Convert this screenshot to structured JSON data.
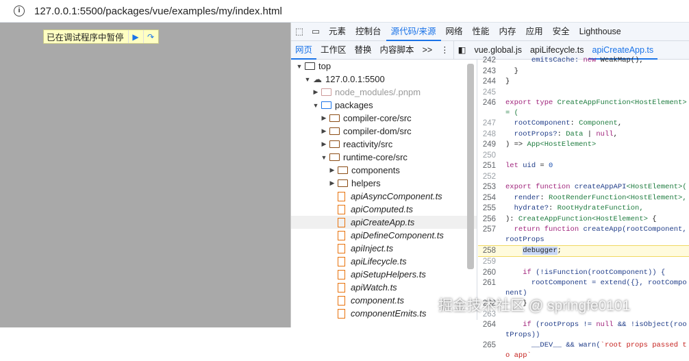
{
  "address_bar": {
    "url": "127.0.0.1:5500/packages/vue/examples/my/index.html"
  },
  "paused_banner": {
    "text": "已在调试程序中暂停"
  },
  "devtools": {
    "main_tabs": [
      "元素",
      "控制台",
      "源代码/来源",
      "网络",
      "性能",
      "内存",
      "应用",
      "安全",
      "Lighthouse"
    ],
    "active_main_tab": 2,
    "sub_tabs": [
      "网页",
      "工作区",
      "替换",
      "内容脚本"
    ],
    "more": ">>",
    "file_tabs": [
      "vue.global.js",
      "apiLifecycle.ts",
      "apiCreateApp.ts"
    ],
    "tree": [
      {
        "label": "top",
        "depth": 0,
        "type": "frame",
        "open": true
      },
      {
        "label": "127.0.0.1:5500",
        "depth": 1,
        "type": "cloud",
        "open": true
      },
      {
        "label": "node_modules/.pnpm",
        "depth": 2,
        "type": "folder-gray",
        "open": false
      },
      {
        "label": "packages",
        "depth": 2,
        "type": "folder-blue",
        "open": true
      },
      {
        "label": "compiler-core/src",
        "depth": 3,
        "type": "folder",
        "open": false
      },
      {
        "label": "compiler-dom/src",
        "depth": 3,
        "type": "folder",
        "open": false
      },
      {
        "label": "reactivity/src",
        "depth": 3,
        "type": "folder",
        "open": false
      },
      {
        "label": "runtime-core/src",
        "depth": 3,
        "type": "folder",
        "open": true
      },
      {
        "label": "components",
        "depth": 4,
        "type": "folder",
        "open": false
      },
      {
        "label": "helpers",
        "depth": 4,
        "type": "folder",
        "open": false
      },
      {
        "label": "apiAsyncComponent.ts",
        "depth": 4,
        "type": "file"
      },
      {
        "label": "apiComputed.ts",
        "depth": 4,
        "type": "file"
      },
      {
        "label": "apiCreateApp.ts",
        "depth": 4,
        "type": "file",
        "selected": true
      },
      {
        "label": "apiDefineComponent.ts",
        "depth": 4,
        "type": "file"
      },
      {
        "label": "apiInject.ts",
        "depth": 4,
        "type": "file"
      },
      {
        "label": "apiLifecycle.ts",
        "depth": 4,
        "type": "file"
      },
      {
        "label": "apiSetupHelpers.ts",
        "depth": 4,
        "type": "file"
      },
      {
        "label": "apiWatch.ts",
        "depth": 4,
        "type": "file"
      },
      {
        "label": "component.ts",
        "depth": 4,
        "type": "file"
      },
      {
        "label": "componentEmits.ts",
        "depth": 4,
        "type": "file"
      }
    ],
    "code": [
      {
        "n": "242",
        "t": [
          [
            "      emitsCache: ",
            "id"
          ],
          [
            "new ",
            "kw"
          ],
          [
            "WeakMap(),",
            "pl"
          ]
        ]
      },
      {
        "n": "243",
        "t": [
          [
            "  }",
            "pl"
          ]
        ]
      },
      {
        "n": "244",
        "t": [
          [
            "}",
            "pl"
          ]
        ]
      },
      {
        "n": "245",
        "t": []
      },
      {
        "n": "246",
        "t": [
          [
            "export type ",
            "kw"
          ],
          [
            "CreateAppFunction<HostElement> = (",
            "ty"
          ]
        ]
      },
      {
        "n": "247",
        "t": [
          [
            "  rootComponent",
            "id"
          ],
          [
            ": ",
            "pl"
          ],
          [
            "Component",
            "ty"
          ],
          [
            ",",
            "pl"
          ]
        ]
      },
      {
        "n": "248",
        "t": [
          [
            "  rootProps?",
            "id"
          ],
          [
            ": ",
            "pl"
          ],
          [
            "Data",
            "ty"
          ],
          [
            " | ",
            "pl"
          ],
          [
            "null",
            "kw"
          ],
          [
            ",",
            "pl"
          ]
        ]
      },
      {
        "n": "249",
        "t": [
          [
            ") => ",
            "pl"
          ],
          [
            "App<HostElement>",
            "ty"
          ]
        ]
      },
      {
        "n": "250",
        "t": []
      },
      {
        "n": "251",
        "t": [
          [
            "let ",
            "kw"
          ],
          [
            "uid",
            "id"
          ],
          [
            " = ",
            "pl"
          ],
          [
            "0",
            "num"
          ]
        ]
      },
      {
        "n": "252",
        "t": []
      },
      {
        "n": "253",
        "t": [
          [
            "export function ",
            "kw"
          ],
          [
            "createAppAPI",
            "id"
          ],
          [
            "<HostElement>(",
            "ty"
          ]
        ]
      },
      {
        "n": "254",
        "t": [
          [
            "  render",
            "id"
          ],
          [
            ": ",
            "pl"
          ],
          [
            "RootRenderFunction<HostElement>,",
            "ty"
          ]
        ]
      },
      {
        "n": "255",
        "t": [
          [
            "  hydrate?",
            "id"
          ],
          [
            ": ",
            "pl"
          ],
          [
            "RootHydrateFunction,",
            "ty"
          ]
        ]
      },
      {
        "n": "256",
        "t": [
          [
            "): ",
            "pl"
          ],
          [
            "CreateAppFunction<HostElement>",
            "ty"
          ],
          [
            " {",
            "pl"
          ]
        ]
      },
      {
        "n": "257",
        "t": [
          [
            "  return function ",
            "kw"
          ],
          [
            "createApp(rootComponent, rootProps",
            "id"
          ]
        ]
      },
      {
        "n": "258",
        "hl": true,
        "t": [
          [
            "    ",
            "pl"
          ],
          [
            "debugger",
            "sel"
          ],
          [
            ";",
            "pl"
          ]
        ]
      },
      {
        "n": "259",
        "t": []
      },
      {
        "n": "260",
        "t": [
          [
            "    if ",
            "kw"
          ],
          [
            "(!isFunction(rootComponent)) {",
            "id"
          ]
        ]
      },
      {
        "n": "261",
        "t": [
          [
            "      rootComponent = extend({}, rootComponent)",
            "id"
          ]
        ]
      },
      {
        "n": "262",
        "t": [
          [
            "    }",
            "pl"
          ]
        ]
      },
      {
        "n": "263",
        "t": []
      },
      {
        "n": "264",
        "t": [
          [
            "    if ",
            "kw"
          ],
          [
            "(rootProps != ",
            "id"
          ],
          [
            "null",
            "kw"
          ],
          [
            " && !isObject(rootProps))",
            "id"
          ]
        ]
      },
      {
        "n": "265",
        "t": [
          [
            "      __DEV__ && warn(",
            "id"
          ],
          [
            "`root props passed to app`",
            "str"
          ]
        ]
      }
    ]
  },
  "watermark": "掘金技术社区 @ springfe0101"
}
